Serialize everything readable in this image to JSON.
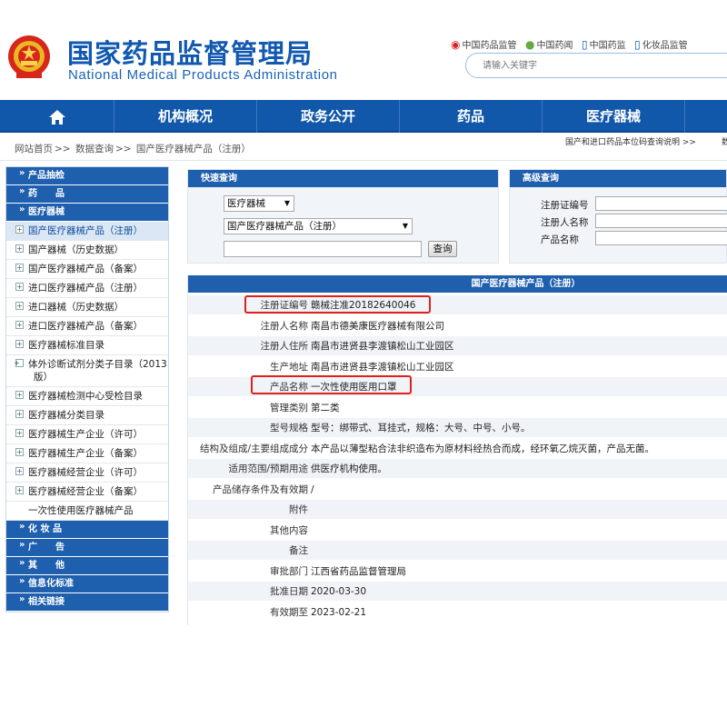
{
  "header": {
    "title_cn": "国家药品监督管理局",
    "title_en": "National Medical Products Administration",
    "links": [
      {
        "icon": "weibo-icon",
        "label": "中国药品监管"
      },
      {
        "icon": "wechat-icon",
        "label": "中国药闻"
      },
      {
        "icon": "mobile-icon",
        "label": "中国药监"
      },
      {
        "icon": "mobile-icon",
        "label": "化妆品监管"
      }
    ],
    "search_placeholder": "请输入关键字"
  },
  "nav": [
    "机构概况",
    "政务公开",
    "药品",
    "医疗器械"
  ],
  "breadcrumb": [
    "网站首页",
    ">>",
    "数据查询",
    ">>",
    "国产医疗器械产品（注册）"
  ],
  "side_note": "国产和进口药品本位码查询说明 >>",
  "side_note_2": "数",
  "menu": [
    {
      "type": "head",
      "label": "产品抽检"
    },
    {
      "type": "head",
      "label": "药　　品"
    },
    {
      "type": "head",
      "label": "医疗器械"
    },
    {
      "type": "sub",
      "label": "国产医疗器械产品（注册）",
      "active": true
    },
    {
      "type": "sub",
      "label": "国产器械（历史数据）"
    },
    {
      "type": "sub",
      "label": "国产医疗器械产品（备案）"
    },
    {
      "type": "sub",
      "label": "进口医疗器械产品（注册）"
    },
    {
      "type": "sub",
      "label": "进口器械（历史数据）"
    },
    {
      "type": "sub",
      "label": "进口医疗器械产品（备案）"
    },
    {
      "type": "sub",
      "label": "医疗器械标准目录"
    },
    {
      "type": "sub",
      "label": "体外诊断试剂分类子目录（2013版）",
      "tall": true
    },
    {
      "type": "sub",
      "label": "医疗器械检测中心受检目录"
    },
    {
      "type": "sub",
      "label": "医疗器械分类目录"
    },
    {
      "type": "sub",
      "label": "医疗器械生产企业（许可）"
    },
    {
      "type": "sub",
      "label": "医疗器械生产企业（备案）"
    },
    {
      "type": "sub",
      "label": "医疗器械经营企业（许可）"
    },
    {
      "type": "sub",
      "label": "医疗器械经营企业（备案）"
    },
    {
      "type": "sub",
      "label": "一次性使用医疗器械产品",
      "nopm": true
    },
    {
      "type": "head",
      "label": "化 妆 品"
    },
    {
      "type": "head",
      "label": "广　　告"
    },
    {
      "type": "head",
      "label": "其　　他"
    },
    {
      "type": "head",
      "label": "信息化标准"
    },
    {
      "type": "head",
      "label": "相关链接"
    }
  ],
  "quick_search": {
    "title": "快速查询",
    "select1": "医疗器械",
    "select2": "国产医疗器械产品（注册）",
    "input_value": "",
    "button": "查询"
  },
  "advanced_search": {
    "title": "高级查询",
    "fields": [
      "注册证编号",
      "注册人名称",
      "产品名称"
    ]
  },
  "detail": {
    "title": "国产医疗器械产品（注册）",
    "rows": [
      {
        "label": "注册证编号",
        "value": "赣械注准20182640046"
      },
      {
        "label": "注册人名称",
        "value": "南昌市德美康医疗器械有限公司"
      },
      {
        "label": "注册人住所",
        "value": "南昌市进贤县李渡镇松山工业园区"
      },
      {
        "label": "生产地址",
        "value": "南昌市进贤县李渡镇松山工业园区"
      },
      {
        "label": "产品名称",
        "value": "一次性使用医用口罩"
      },
      {
        "label": "管理类别",
        "value": "第二类"
      },
      {
        "label": "型号规格",
        "value": "型号：绑带式、耳挂式，规格：大号、中号、小号。"
      },
      {
        "label": "结构及组成/主要组成成分",
        "value": "本产品以薄型粘合法非织造布为原材料经热合而成，经环氧乙烷灭菌，产品无菌。"
      },
      {
        "label": "适用范围/预期用途",
        "value": "供医疗机构使用。"
      },
      {
        "label": "产品储存条件及有效期",
        "value": "/"
      },
      {
        "label": "附件",
        "value": ""
      },
      {
        "label": "其他内容",
        "value": ""
      },
      {
        "label": "备注",
        "value": ""
      },
      {
        "label": "审批部门",
        "value": "江西省药品监督管理局"
      },
      {
        "label": "批准日期",
        "value": "2020-03-30"
      },
      {
        "label": "有效期至",
        "value": "2023-02-21"
      }
    ]
  },
  "colors": {
    "brand": "#1157aa",
    "highlight": "#e0201c"
  }
}
